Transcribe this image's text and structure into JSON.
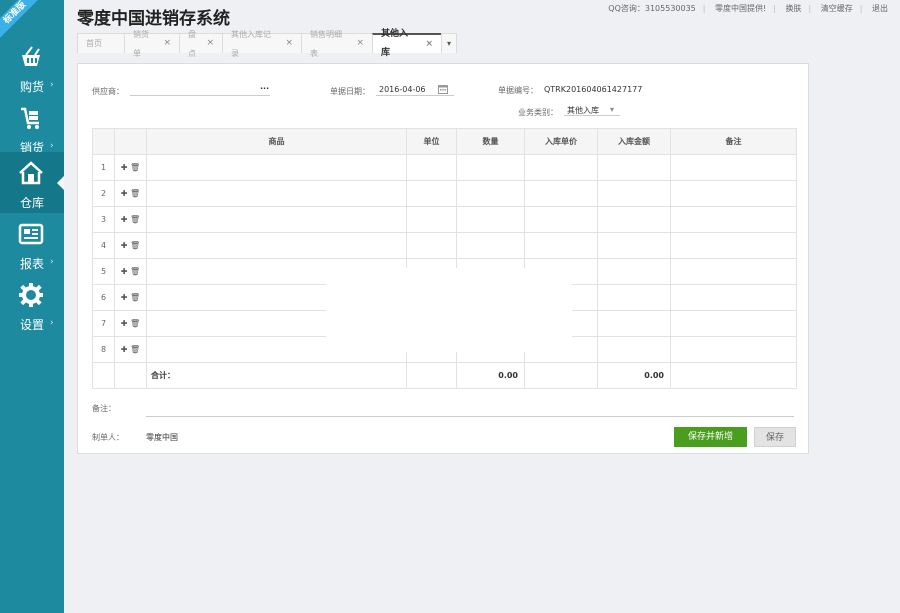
{
  "ribbon": "标准版",
  "app": {
    "title": "零度中国进销存系统"
  },
  "topnav": {
    "qq": "QQ咨询：3105530035",
    "provider": "零度中国提供!",
    "skin": "换肤",
    "clear": "清空缓存",
    "logout": "退出"
  },
  "sidebar": {
    "items": [
      {
        "label": "购货",
        "icon": "basket-icon"
      },
      {
        "label": "销货",
        "icon": "cart-icon"
      },
      {
        "label": "仓库",
        "icon": "house-icon"
      },
      {
        "label": "报表",
        "icon": "report-icon"
      },
      {
        "label": "设置",
        "icon": "gear-icon"
      }
    ],
    "active": "仓库",
    "arrow": "›"
  },
  "tabs": [
    {
      "label": "首页"
    },
    {
      "label": "销货单"
    },
    {
      "label": "盘点"
    },
    {
      "label": "其他入库记录"
    },
    {
      "label": "销售明细表"
    },
    {
      "label": "其他入库"
    }
  ],
  "tab_close": "×",
  "tab_more": "▾",
  "form": {
    "supplier_label": "供应商：",
    "supplier_value": "",
    "supplier_more": "···",
    "date_label": "单据日期：",
    "date_value": "2016-04-06",
    "docno_label": "单据编号：",
    "docno_value": "QTRK201604061427177",
    "biztype_label": "业务类别：",
    "biztype_value": "其他入库",
    "biztype_arrow": "▾"
  },
  "table": {
    "headers": [
      "商品",
      "单位",
      "数量",
      "入库单价",
      "入库金额",
      "备注"
    ],
    "rows": [
      "1",
      "2",
      "3",
      "4",
      "5",
      "6",
      "7",
      "8"
    ],
    "ops": "✚ 🗑",
    "total_label": "合计：",
    "total_qty": "0.00",
    "total_amount": "0.00"
  },
  "footer": {
    "remark_label": "备注：",
    "maker_label": "制单人：",
    "maker_value": "零度中国",
    "save_new": "保存并新增",
    "save": "保存"
  },
  "colors": {
    "sidebar": "#1e8aa0",
    "active": "#14778a",
    "primary_button": "#4a9e1f"
  }
}
